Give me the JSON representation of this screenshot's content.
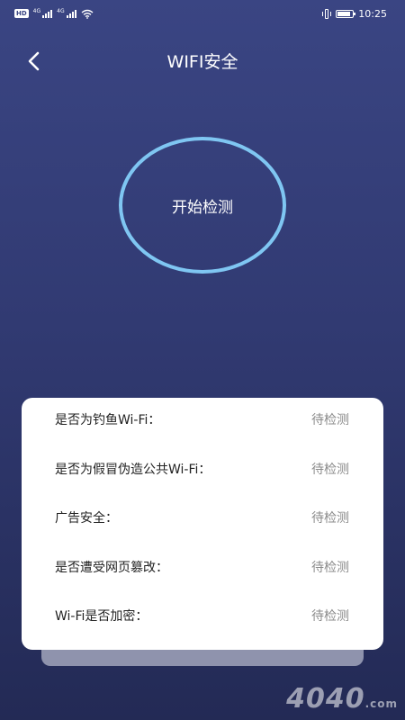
{
  "status_bar": {
    "hd": "HD",
    "sig1": "4G",
    "sig2": "4G",
    "time": "10:25"
  },
  "header": {
    "title": "WIFI安全"
  },
  "scan": {
    "button_label": "开始检测",
    "ring_color": "#7fc6f2"
  },
  "results": [
    {
      "label": "是否为钓鱼Wi-Fi：",
      "status": "待检测"
    },
    {
      "label": "是否为假冒伪造公共Wi-Fi：",
      "status": "待检测"
    },
    {
      "label": "广告安全：",
      "status": "待检测"
    },
    {
      "label": "是否遭受网页篡改：",
      "status": "待检测"
    },
    {
      "label": "Wi-Fi是否加密：",
      "status": "待检测"
    }
  ],
  "watermark": {
    "main": "4040",
    "suffix": ".com"
  },
  "colors": {
    "background_top": "#3a4583",
    "background_bottom": "#232a55",
    "card": "#ffffff",
    "status_text": "#8a8a8a"
  }
}
